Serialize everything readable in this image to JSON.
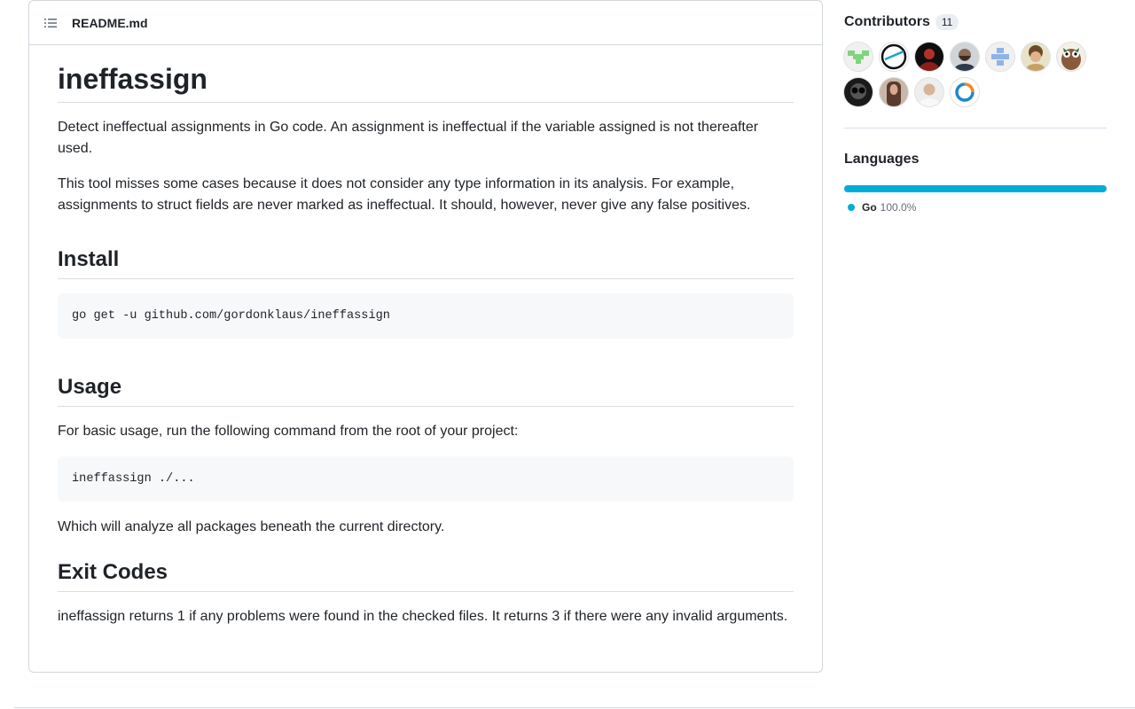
{
  "readme": {
    "filename": "README.md",
    "title": "ineffassign",
    "intro_p1": "Detect ineffectual assignments in Go code. An assignment is ineffectual if the variable assigned is not thereafter used.",
    "intro_p2": "This tool misses some cases because it does not consider any type information in its analysis. For example, assignments to struct fields are never marked as ineffectual. It should, however, never give any false positives.",
    "install": {
      "heading": "Install",
      "code": "go get -u github.com/gordonklaus/ineffassign"
    },
    "usage": {
      "heading": "Usage",
      "text": "For basic usage, run the following command from the root of your project:",
      "code": "ineffassign ./...",
      "after": "Which will analyze all packages beneath the current directory."
    },
    "exit_codes": {
      "heading": "Exit Codes",
      "text": "ineffassign returns 1 if any problems were found in the checked files. It returns 3 if there were any invalid arguments."
    }
  },
  "sidebar": {
    "contributors": {
      "title": "Contributors",
      "count": "11",
      "avatars": [
        {
          "name": "identicon-green-avatar",
          "color": "#7ed67a"
        },
        {
          "name": "swoosh-logo-avatar",
          "color": "#16a6c8"
        },
        {
          "name": "red-portrait-avatar",
          "color": "#b2302a"
        },
        {
          "name": "bearded-portrait-avatar",
          "color": "#4a4a4a"
        },
        {
          "name": "identicon-blue-avatar",
          "color": "#8fb3e8"
        },
        {
          "name": "curly-hair-portrait-avatar",
          "color": "#c8a064"
        },
        {
          "name": "gopher-avatar",
          "color": "#8a5a3c"
        },
        {
          "name": "sunglasses-portrait-avatar",
          "color": "#222222"
        },
        {
          "name": "long-hair-portrait-avatar",
          "color": "#8a5a4c"
        },
        {
          "name": "bald-portrait-avatar",
          "color": "#d6d2cc"
        },
        {
          "name": "ring-logo-avatar",
          "color": "#1e88c8"
        }
      ]
    },
    "languages": {
      "title": "Languages",
      "items": [
        {
          "name": "Go",
          "percent": "100.0%",
          "fraction": 1.0,
          "color": "#00ADD8"
        }
      ]
    }
  }
}
